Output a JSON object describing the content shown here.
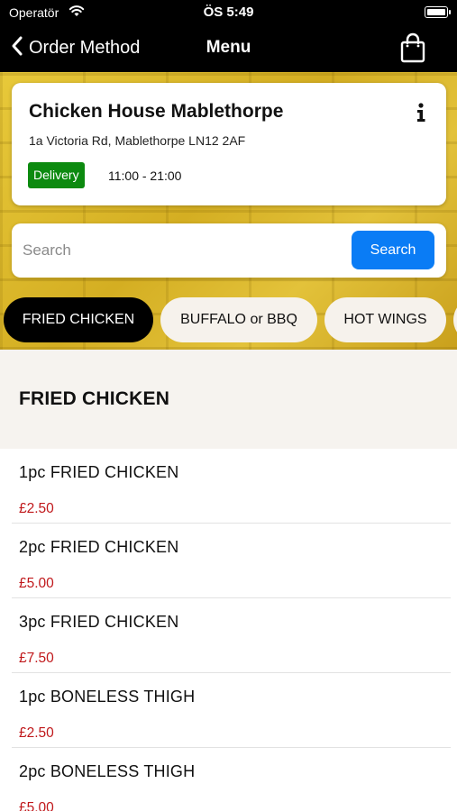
{
  "status_bar": {
    "carrier": "Operatör",
    "time": "ÖS 5:49"
  },
  "nav": {
    "back_label": "Order Method",
    "title": "Menu"
  },
  "restaurant": {
    "name": "Chicken House Mablethorpe",
    "address": "1a Victoria Rd, Mablethorpe LN12 2AF",
    "badge": "Delivery",
    "hours": "11:00 - 21:00"
  },
  "search": {
    "placeholder": "Search",
    "button_label": "Search"
  },
  "categories": [
    {
      "label": "FRIED CHICKEN",
      "active": true
    },
    {
      "label": "BUFFALO or BBQ",
      "active": false
    },
    {
      "label": "HOT WINGS",
      "active": false
    }
  ],
  "section_title": "FRIED CHICKEN",
  "items": [
    {
      "name": "1pc FRIED CHICKEN",
      "price": "£2.50"
    },
    {
      "name": "2pc FRIED CHICKEN",
      "price": "£5.00"
    },
    {
      "name": "3pc FRIED CHICKEN",
      "price": "£7.50"
    },
    {
      "name": "1pc BONELESS THIGH",
      "price": "£2.50"
    },
    {
      "name": "2pc BONELESS THIGH",
      "price": "£5.00"
    }
  ],
  "colors": {
    "badge_green": "#0c8a0f",
    "search_blue": "#0a7cf5",
    "price_red": "#c0181b"
  }
}
